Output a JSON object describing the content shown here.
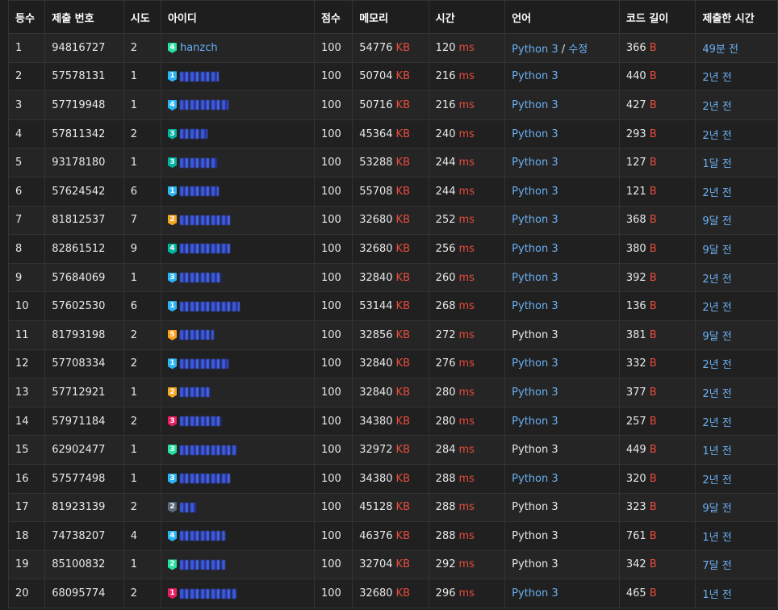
{
  "headers": [
    "등수",
    "제출 번호",
    "시도",
    "아이디",
    "점수",
    "메모리",
    "시간",
    "언어",
    "코드 길이",
    "제출한 시간"
  ],
  "units": {
    "memory": "KB",
    "time": "ms",
    "code": "B"
  },
  "tier_colors": {
    "4": "#27e2a4",
    "1": "#2cb5f5",
    "3": "#00b4a0",
    "2": "#f5a623",
    "5": "#ff9f1c",
    "R": "#e91e63",
    "G": "#5c6b7a"
  },
  "rows": [
    {
      "rank": "1",
      "submission": "94816727",
      "tries": "2",
      "tier": "4",
      "tier_color": "#27e2a4",
      "user": "hanzch",
      "blur_w": 0,
      "score": "100",
      "memory": "54776",
      "time": "120",
      "lang": "Python 3",
      "lang_link": true,
      "edit": "수정",
      "code": "366",
      "when": "49분 전"
    },
    {
      "rank": "2",
      "submission": "57578131",
      "tries": "1",
      "tier": "1",
      "tier_color": "#2cb5f5",
      "user": "",
      "blur_w": 48,
      "score": "100",
      "memory": "50704",
      "time": "216",
      "lang": "Python 3",
      "lang_link": true,
      "edit": "",
      "code": "440",
      "when": "2년 전"
    },
    {
      "rank": "3",
      "submission": "57719948",
      "tries": "1",
      "tier": "4",
      "tier_color": "#2cb5f5",
      "user": "",
      "blur_w": 60,
      "score": "100",
      "memory": "50716",
      "time": "216",
      "lang": "Python 3",
      "lang_link": true,
      "edit": "",
      "code": "427",
      "when": "2년 전"
    },
    {
      "rank": "4",
      "submission": "57811342",
      "tries": "2",
      "tier": "3",
      "tier_color": "#00b4a0",
      "user": "",
      "blur_w": 34,
      "score": "100",
      "memory": "45364",
      "time": "240",
      "lang": "Python 3",
      "lang_link": true,
      "edit": "",
      "code": "293",
      "when": "2년 전"
    },
    {
      "rank": "5",
      "submission": "93178180",
      "tries": "1",
      "tier": "3",
      "tier_color": "#00b4a0",
      "user": "",
      "blur_w": 46,
      "score": "100",
      "memory": "53288",
      "time": "244",
      "lang": "Python 3",
      "lang_link": true,
      "edit": "",
      "code": "127",
      "when": "1달 전"
    },
    {
      "rank": "6",
      "submission": "57624542",
      "tries": "6",
      "tier": "1",
      "tier_color": "#2cb5f5",
      "user": "",
      "blur_w": 48,
      "score": "100",
      "memory": "55708",
      "time": "244",
      "lang": "Python 3",
      "lang_link": true,
      "edit": "",
      "code": "121",
      "when": "2년 전"
    },
    {
      "rank": "7",
      "submission": "81812537",
      "tries": "7",
      "tier": "2",
      "tier_color": "#f5a623",
      "user": "",
      "blur_w": 62,
      "score": "100",
      "memory": "32680",
      "time": "252",
      "lang": "Python 3",
      "lang_link": true,
      "edit": "",
      "code": "368",
      "when": "9달 전"
    },
    {
      "rank": "8",
      "submission": "82861512",
      "tries": "9",
      "tier": "4",
      "tier_color": "#00b4a0",
      "user": "",
      "blur_w": 62,
      "score": "100",
      "memory": "32680",
      "time": "256",
      "lang": "Python 3",
      "lang_link": true,
      "edit": "",
      "code": "380",
      "when": "9달 전"
    },
    {
      "rank": "9",
      "submission": "57684069",
      "tries": "1",
      "tier": "3",
      "tier_color": "#2cb5f5",
      "user": "",
      "blur_w": 52,
      "score": "100",
      "memory": "32840",
      "time": "260",
      "lang": "Python 3",
      "lang_link": true,
      "edit": "",
      "code": "392",
      "when": "2년 전"
    },
    {
      "rank": "10",
      "submission": "57602530",
      "tries": "6",
      "tier": "1",
      "tier_color": "#2cb5f5",
      "user": "",
      "blur_w": 74,
      "score": "100",
      "memory": "53144",
      "time": "268",
      "lang": "Python 3",
      "lang_link": true,
      "edit": "",
      "code": "136",
      "when": "2년 전"
    },
    {
      "rank": "11",
      "submission": "81793198",
      "tries": "2",
      "tier": "5",
      "tier_color": "#ff9f1c",
      "user": "",
      "blur_w": 42,
      "score": "100",
      "memory": "32856",
      "time": "272",
      "lang": "Python 3",
      "lang_link": false,
      "edit": "",
      "code": "381",
      "when": "9달 전"
    },
    {
      "rank": "12",
      "submission": "57708334",
      "tries": "2",
      "tier": "1",
      "tier_color": "#2cb5f5",
      "user": "",
      "blur_w": 60,
      "score": "100",
      "memory": "32840",
      "time": "276",
      "lang": "Python 3",
      "lang_link": true,
      "edit": "",
      "code": "332",
      "when": "2년 전"
    },
    {
      "rank": "13",
      "submission": "57712921",
      "tries": "1",
      "tier": "2",
      "tier_color": "#f5a623",
      "user": "",
      "blur_w": 38,
      "score": "100",
      "memory": "32840",
      "time": "280",
      "lang": "Python 3",
      "lang_link": true,
      "edit": "",
      "code": "377",
      "when": "2년 전"
    },
    {
      "rank": "14",
      "submission": "57971184",
      "tries": "2",
      "tier": "3",
      "tier_color": "#e91e63",
      "user": "",
      "blur_w": 52,
      "score": "100",
      "memory": "34380",
      "time": "280",
      "lang": "Python 3",
      "lang_link": true,
      "edit": "",
      "code": "257",
      "when": "2년 전"
    },
    {
      "rank": "15",
      "submission": "62902477",
      "tries": "1",
      "tier": "3",
      "tier_color": "#27e2a4",
      "user": "",
      "blur_w": 70,
      "score": "100",
      "memory": "32972",
      "time": "284",
      "lang": "Python 3",
      "lang_link": false,
      "edit": "",
      "code": "449",
      "when": "1년 전"
    },
    {
      "rank": "16",
      "submission": "57577498",
      "tries": "1",
      "tier": "3",
      "tier_color": "#2cb5f5",
      "user": "",
      "blur_w": 62,
      "score": "100",
      "memory": "34380",
      "time": "288",
      "lang": "Python 3",
      "lang_link": true,
      "edit": "",
      "code": "320",
      "when": "2년 전"
    },
    {
      "rank": "17",
      "submission": "81923139",
      "tries": "2",
      "tier": "2",
      "tier_color": "#5c6b7a",
      "user": "",
      "blur_w": 20,
      "score": "100",
      "memory": "45128",
      "time": "288",
      "lang": "Python 3",
      "lang_link": false,
      "edit": "",
      "code": "323",
      "when": "9달 전"
    },
    {
      "rank": "18",
      "submission": "74738207",
      "tries": "4",
      "tier": "4",
      "tier_color": "#2cb5f5",
      "user": "",
      "blur_w": 56,
      "score": "100",
      "memory": "46376",
      "time": "288",
      "lang": "Python 3",
      "lang_link": false,
      "edit": "",
      "code": "761",
      "when": "1년 전"
    },
    {
      "rank": "19",
      "submission": "85100832",
      "tries": "1",
      "tier": "2",
      "tier_color": "#27e2a4",
      "user": "",
      "blur_w": 56,
      "score": "100",
      "memory": "32704",
      "time": "292",
      "lang": "Python 3",
      "lang_link": false,
      "edit": "",
      "code": "342",
      "when": "7달 전"
    },
    {
      "rank": "20",
      "submission": "68095774",
      "tries": "2",
      "tier": "1",
      "tier_color": "#e91e63",
      "user": "",
      "blur_w": 70,
      "score": "100",
      "memory": "32680",
      "time": "296",
      "lang": "Python 3",
      "lang_link": true,
      "edit": "",
      "code": "465",
      "when": "1년 전"
    }
  ]
}
